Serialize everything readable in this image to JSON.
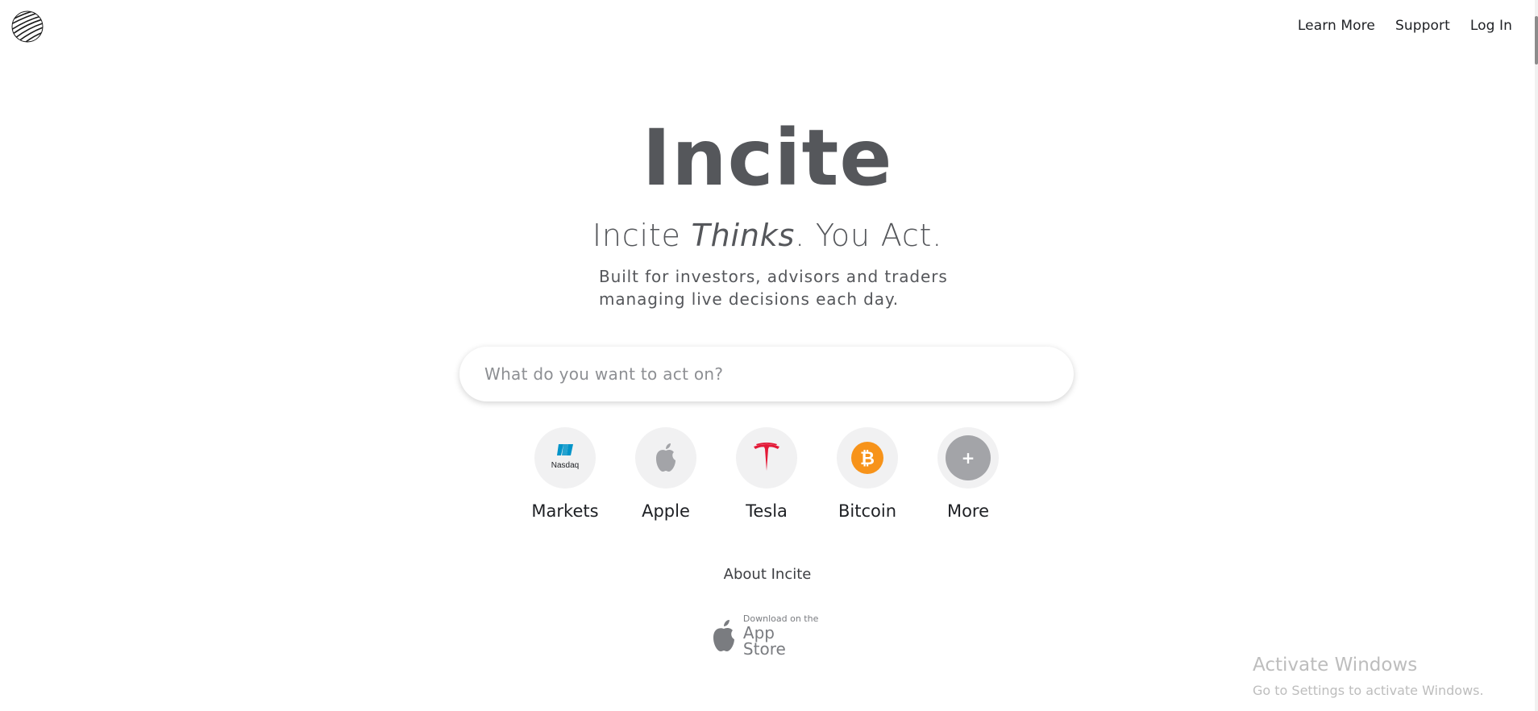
{
  "header": {
    "logo": "fingerprint-logo",
    "nav": [
      {
        "label": "Learn More"
      },
      {
        "label": "Support"
      },
      {
        "label": "Log In"
      }
    ]
  },
  "hero": {
    "title": "Incite",
    "tagline_pre": "Incite ",
    "tagline_em": "Thinks",
    "tagline_post": ". You Act.",
    "subtitle_line1": "Built for investors, advisors and traders",
    "subtitle_line2": "managing live decisions each day."
  },
  "search": {
    "placeholder": "What do you want to act on?",
    "value": ""
  },
  "quick_links": [
    {
      "label": "Markets",
      "icon": "nasdaq-icon",
      "icon_text": "Nasdaq"
    },
    {
      "label": "Apple",
      "icon": "apple-icon"
    },
    {
      "label": "Tesla",
      "icon": "tesla-icon"
    },
    {
      "label": "Bitcoin",
      "icon": "bitcoin-icon",
      "icon_text": "₿"
    },
    {
      "label": "More",
      "icon": "plus-icon",
      "icon_text": "+"
    }
  ],
  "footer": {
    "about": "About Incite",
    "appstore_small": "Download on the",
    "appstore_big": "App Store"
  },
  "watermark": {
    "line1": "Activate Windows",
    "line2": "Go to Settings to activate Windows."
  },
  "colors": {
    "title": "#55575b",
    "nasdaq_blue": "#0094c9",
    "tesla_red": "#e31937",
    "bitcoin_orange": "#f7931a",
    "more_grey": "#a3a4a8"
  }
}
